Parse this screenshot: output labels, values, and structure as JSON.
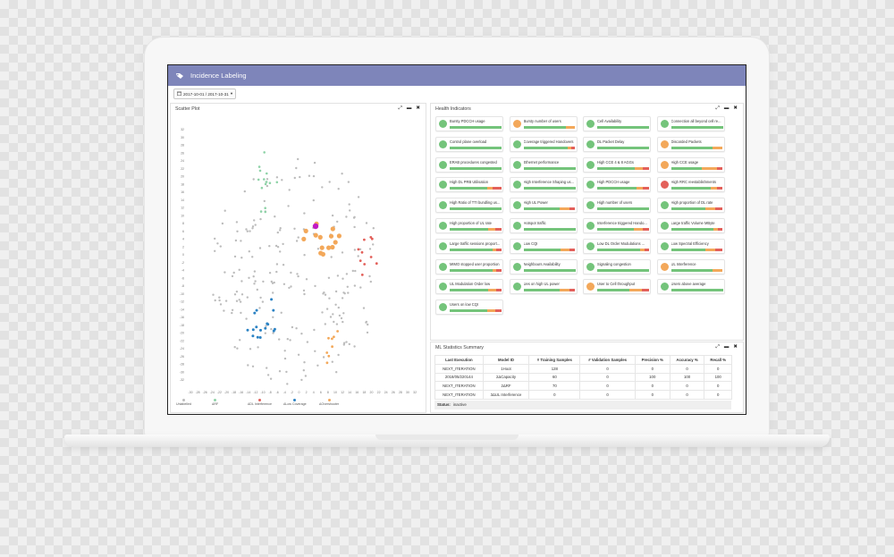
{
  "app": {
    "title": "Incidence Labeling",
    "date_range": "2017-10-01 / 2017-10-31"
  },
  "colors": {
    "header": "#7e85ba",
    "green": "#74c47b",
    "orange": "#f3a85a",
    "red": "#e3605a",
    "magenta": "#c21bc4",
    "blue": "#2c83c4",
    "grey": "#bcbcbc",
    "teal": "#8fd3a8"
  },
  "scatter": {
    "title": "Scatter Plot",
    "y_ticks": [
      "32",
      "30",
      "28",
      "26",
      "24",
      "22",
      "20",
      "18",
      "16",
      "14",
      "12",
      "10",
      "8",
      "6",
      "4",
      "2",
      "0",
      "-2",
      "-4",
      "-6",
      "-8",
      "-10",
      "-12",
      "-14",
      "-16",
      "-18",
      "-20",
      "-22",
      "-24",
      "-26",
      "-28",
      "-30",
      "-32"
    ],
    "x_ticks": [
      "-30",
      "-28",
      "-26",
      "-24",
      "-22",
      "-20",
      "-18",
      "-16",
      "-14",
      "-12",
      "-10",
      "-8",
      "-6",
      "-4",
      "-2",
      "0",
      "2",
      "4",
      "6",
      "8",
      "10",
      "12",
      "14",
      "16",
      "18",
      "20",
      "22",
      "24",
      "26",
      "28",
      "30",
      "32"
    ],
    "legend": [
      {
        "label": "Unlabelled",
        "color": "#bcbcbc"
      },
      {
        "label": "ΔRF",
        "color": "#8fd3a8"
      },
      {
        "label": "ΔDL Interference",
        "color": "#e3605a"
      },
      {
        "label": "ΔLow Coverage",
        "color": "#2c83c4"
      },
      {
        "label": "ΔOvershooter",
        "color": "#f3a85a"
      }
    ]
  },
  "health": {
    "title": "Health Indicators",
    "items": [
      {
        "label": "Bursty PDCCH usage",
        "status": "green",
        "bar": [
          1,
          0,
          0
        ]
      },
      {
        "label": "Bursty number of users",
        "status": "orange",
        "bar": [
          0.82,
          0.18,
          0
        ]
      },
      {
        "label": "Cell Availability",
        "status": "green",
        "bar": [
          1,
          0,
          0
        ]
      },
      {
        "label": "Connection all beyond cell re...",
        "status": "green",
        "bar": [
          1,
          0,
          0
        ]
      },
      {
        "label": "Control plane overload",
        "status": "green",
        "bar": [
          1,
          0,
          0
        ]
      },
      {
        "label": "Coverage triggered Handovers",
        "status": "green",
        "bar": [
          0.86,
          0.06,
          0.08
        ]
      },
      {
        "label": "DL Packet Delay",
        "status": "green",
        "bar": [
          1,
          0,
          0
        ]
      },
      {
        "label": "Discarded Packets",
        "status": "orange",
        "bar": [
          0.8,
          0.2,
          0
        ]
      },
      {
        "label": "ERAB procedures congested",
        "status": "green",
        "bar": [
          1,
          0,
          0
        ]
      },
      {
        "label": "Ethernet performance",
        "status": "green",
        "bar": [
          1,
          0,
          0
        ]
      },
      {
        "label": "High CCE 4 & 8 AGGs",
        "status": "green",
        "bar": [
          0.72,
          0.16,
          0.12
        ]
      },
      {
        "label": "High CCE usage",
        "status": "orange",
        "bar": [
          0.6,
          0.28,
          0.12
        ]
      },
      {
        "label": "High DL PRB Utilisation",
        "status": "green",
        "bar": [
          0.72,
          0.1,
          0.18
        ]
      },
      {
        "label": "High Interference Shaping us...",
        "status": "green",
        "bar": [
          1,
          0,
          0
        ]
      },
      {
        "label": "High PDCCH usage",
        "status": "green",
        "bar": [
          0.76,
          0.12,
          0.12
        ]
      },
      {
        "label": "High RRC reestablishments",
        "status": "red",
        "bar": [
          0.76,
          0.12,
          0.12
        ]
      },
      {
        "label": "High Ratio of TTI bundling us...",
        "status": "green",
        "bar": [
          1,
          0,
          0
        ]
      },
      {
        "label": "High UL Power",
        "status": "green",
        "bar": [
          0.7,
          0.18,
          0.12
        ]
      },
      {
        "label": "High number of users",
        "status": "green",
        "bar": [
          1,
          0,
          0
        ]
      },
      {
        "label": "High proportion of DL rate",
        "status": "green",
        "bar": [
          0.66,
          0.2,
          0.14
        ]
      },
      {
        "label": "High proportion of UL rate",
        "status": "green",
        "bar": [
          0.74,
          0.14,
          0.12
        ]
      },
      {
        "label": "Hotspot traffic",
        "status": "green",
        "bar": [
          1,
          0,
          0
        ]
      },
      {
        "label": "Interference triggered Hando...",
        "status": "green",
        "bar": [
          0.7,
          0.18,
          0.12
        ]
      },
      {
        "label": "Large traffic Volume MByte",
        "status": "green",
        "bar": [
          0.82,
          0.08,
          0.1
        ]
      },
      {
        "label": "Large traffic sessions proport...",
        "status": "green",
        "bar": [
          0.82,
          0.08,
          0.1
        ]
      },
      {
        "label": "Low CQI",
        "status": "green",
        "bar": [
          0.72,
          0.16,
          0.12
        ]
      },
      {
        "label": "Low DL Order Modulations ...",
        "status": "green",
        "bar": [
          0.82,
          0.1,
          0.08
        ]
      },
      {
        "label": "Low Spectral Efficiency",
        "status": "green",
        "bar": [
          0.66,
          0.2,
          0.14
        ]
      },
      {
        "label": "MIMO stopped user proportion",
        "status": "green",
        "bar": [
          0.82,
          0.08,
          0.1
        ]
      },
      {
        "label": "Neighbours Availability",
        "status": "green",
        "bar": [
          1,
          0,
          0
        ]
      },
      {
        "label": "Signaling congestion",
        "status": "green",
        "bar": [
          1,
          0,
          0
        ]
      },
      {
        "label": "UL Interference",
        "status": "orange",
        "bar": [
          0.8,
          0.2,
          0
        ]
      },
      {
        "label": "UL Modulation Order low",
        "status": "green",
        "bar": [
          0.74,
          0.16,
          0.1
        ]
      },
      {
        "label": "Ues on high UL power",
        "status": "green",
        "bar": [
          0.7,
          0.18,
          0.12
        ]
      },
      {
        "label": "User to Cell throughput",
        "status": "orange",
        "bar": [
          0.62,
          0.24,
          0.14
        ]
      },
      {
        "label": "Users above average",
        "status": "green",
        "bar": [
          1,
          0,
          0
        ]
      },
      {
        "label": "Users on low CQI",
        "status": "green",
        "bar": [
          0.72,
          0.16,
          0.12
        ]
      }
    ]
  },
  "ml": {
    "title": "ML Statistics Summary",
    "columns": [
      "Last Execution",
      "Model ID",
      "# Training Samples",
      "# Validation Samples",
      "Precision %",
      "Accuracy %",
      "Recall %"
    ],
    "rows": [
      [
        "NEXT_ITERATION",
        "1Hoot",
        "128",
        "0",
        "0",
        "0",
        "0"
      ],
      [
        "2018/05/220144",
        "2ΔCapacity",
        "60",
        "0",
        "100",
        "100",
        "100"
      ],
      [
        "NEXT_ITERATION",
        "2ΔRF",
        "70",
        "0",
        "0",
        "0",
        "0"
      ],
      [
        "NEXT_ITERATION",
        "3ΔUL Interference",
        "0",
        "0",
        "0",
        "0",
        "0"
      ]
    ],
    "status_label": "Status:",
    "status_value": "inactive"
  }
}
